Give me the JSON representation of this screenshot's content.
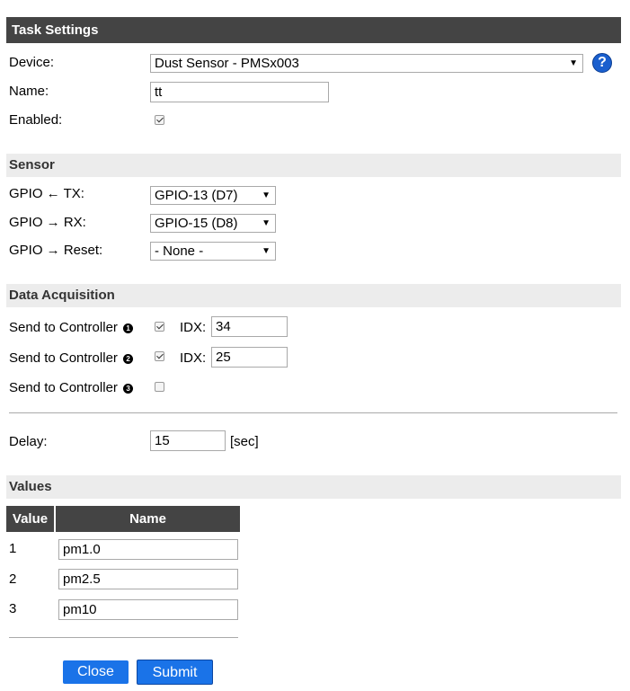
{
  "task_settings": {
    "title": "Task Settings",
    "device_label": "Device:",
    "device_value": "Dust Sensor - PMSx003",
    "help_glyph": "?",
    "name_label": "Name:",
    "name_value": "tt",
    "enabled_label": "Enabled:",
    "enabled_checked": true
  },
  "sensor": {
    "title": "Sensor",
    "gpio_tx_label": "GPIO ← TX:",
    "gpio_tx_value": "GPIO-13 (D7)",
    "gpio_rx_label": "GPIO → RX:",
    "gpio_rx_value": "GPIO-15 (D8)",
    "gpio_reset_label": "GPIO → Reset:",
    "gpio_reset_value": "- None -"
  },
  "data_acquisition": {
    "title": "Data Acquisition",
    "controllers": [
      {
        "label": "Send to Controller",
        "number": "1",
        "checked": true,
        "idx_label": "IDX:",
        "idx_value": "34"
      },
      {
        "label": "Send to Controller",
        "number": "2",
        "checked": true,
        "idx_label": "IDX:",
        "idx_value": "25"
      },
      {
        "label": "Send to Controller",
        "number": "3",
        "checked": false
      }
    ],
    "delay_label": "Delay:",
    "delay_value": "15",
    "delay_unit": "[sec]"
  },
  "values": {
    "title": "Values",
    "col_value": "Value",
    "col_name": "Name",
    "rows": [
      {
        "value": "1",
        "name": "pm1.0"
      },
      {
        "value": "2",
        "name": "pm2.5"
      },
      {
        "value": "3",
        "name": "pm10"
      }
    ]
  },
  "buttons": {
    "close_label": "Close",
    "submit_label": "Submit"
  },
  "colors": {
    "header_bg": "#444444",
    "section_bg": "#ececec",
    "button_bg": "#1a73e8"
  }
}
